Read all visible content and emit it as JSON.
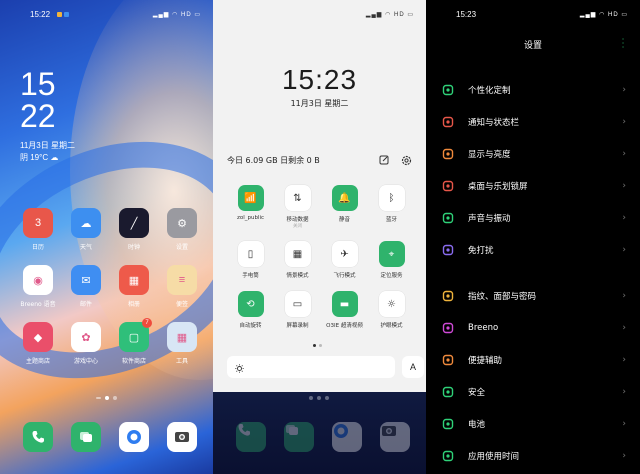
{
  "home": {
    "status_time": "15:22",
    "status_icons": "HD",
    "clock_hour": "15",
    "clock_min": "22",
    "date": "11月3日 星期二",
    "weather": "阴 19°C",
    "apps": [
      {
        "label": "日历",
        "icon": "calendar-icon",
        "color": "#e8574a",
        "glyph": "3"
      },
      {
        "label": "天气",
        "icon": "weather-icon",
        "color": "#3d8ff0",
        "glyph": "☁"
      },
      {
        "label": "时钟",
        "icon": "clock-icon",
        "color": "#1a1a2e",
        "glyph": "╱"
      },
      {
        "label": "设置",
        "icon": "settings-icon",
        "color": "#9a9aa0",
        "glyph": "⚙"
      },
      {
        "label": "Breeno 语音",
        "icon": "breeno-icon",
        "color": "#ffffff",
        "glyph": "◉"
      },
      {
        "label": "邮件",
        "icon": "mail-icon",
        "color": "#3f8ef2",
        "glyph": "✉"
      },
      {
        "label": "相册",
        "icon": "photos-icon",
        "color": "#ee5a4a",
        "glyph": "▦"
      },
      {
        "label": "便签",
        "icon": "notes-icon",
        "color": "#f6dca6",
        "glyph": "≡"
      },
      {
        "label": "主题商店",
        "icon": "theme-store-icon",
        "color": "#ea4f6a",
        "glyph": "◆"
      },
      {
        "label": "游戏中心",
        "icon": "game-center-icon",
        "color": "#ffffff",
        "glyph": "✿"
      },
      {
        "label": "软件商店",
        "icon": "app-store-icon",
        "color": "#2fbf7a",
        "glyph": "▢",
        "badge": "7"
      },
      {
        "label": "工具",
        "icon": "tools-folder-icon",
        "color": "#d8e6f5",
        "glyph": "▦"
      }
    ],
    "dock": [
      {
        "icon": "phone-icon",
        "color": "#2fb36c"
      },
      {
        "icon": "messages-icon",
        "color": "#2fb36c"
      },
      {
        "icon": "browser-icon",
        "color": "#ffffff"
      },
      {
        "icon": "camera-icon",
        "color": "#ffffff"
      }
    ]
  },
  "cc": {
    "status_icons": "HD",
    "time": "15:23",
    "date": "11月3日 星期二",
    "data_usage": "今日 6.09 GB 日剩余 0 B",
    "tiles": [
      {
        "label": "zol_public",
        "sub": "",
        "on": true,
        "icon": "wifi-icon",
        "glyph": "📶"
      },
      {
        "label": "移动数据",
        "sub": "关闭",
        "on": false,
        "icon": "mobile-data-icon",
        "glyph": "⇅"
      },
      {
        "label": "静音",
        "sub": "",
        "on": true,
        "icon": "mute-icon",
        "glyph": "🔔"
      },
      {
        "label": "蓝牙",
        "sub": "",
        "on": false,
        "icon": "bluetooth-icon",
        "glyph": "ᛒ"
      },
      {
        "label": "手电筒",
        "sub": "",
        "on": false,
        "icon": "flashlight-icon",
        "glyph": "▯"
      },
      {
        "label": "情景模式",
        "sub": "",
        "on": false,
        "icon": "scene-mode-icon",
        "glyph": "▦"
      },
      {
        "label": "飞行模式",
        "sub": "",
        "on": false,
        "icon": "airplane-icon",
        "glyph": "✈"
      },
      {
        "label": "定位服务",
        "sub": "",
        "on": true,
        "icon": "location-icon",
        "glyph": "⌖"
      },
      {
        "label": "自动旋转",
        "sub": "",
        "on": true,
        "icon": "auto-rotate-icon",
        "glyph": "⟲"
      },
      {
        "label": "屏幕录制",
        "sub": "",
        "on": false,
        "icon": "screen-record-icon",
        "glyph": "▭"
      },
      {
        "label": "O3IE 超清视频",
        "sub": "",
        "on": true,
        "icon": "video-enhance-icon",
        "glyph": "▬"
      },
      {
        "label": "护眼模式",
        "sub": "",
        "on": false,
        "icon": "eye-comfort-icon",
        "glyph": "☼"
      }
    ],
    "auto_brightness_label": "A"
  },
  "settings": {
    "status_time": "15:23",
    "status_icons": "HD",
    "title": "设置",
    "groups": [
      [
        {
          "label": "个性化定制",
          "icon": "palette-icon",
          "color": "#2fd279"
        },
        {
          "label": "通知与状态栏",
          "icon": "notification-icon",
          "color": "#e8574a"
        },
        {
          "label": "显示与亮度",
          "icon": "display-icon",
          "color": "#f08a3c"
        },
        {
          "label": "桌面与乐划锁屏",
          "icon": "desktop-icon",
          "color": "#e8574a"
        },
        {
          "label": "声音与振动",
          "icon": "sound-icon",
          "color": "#2fd279"
        },
        {
          "label": "免打扰",
          "icon": "moon-icon",
          "color": "#8a6cf0"
        }
      ],
      [
        {
          "label": "指纹、面部与密码",
          "icon": "fingerprint-icon",
          "color": "#f0b43c"
        },
        {
          "label": "Breeno",
          "icon": "breeno-icon",
          "color": "#d04ad8"
        },
        {
          "label": "便捷辅助",
          "icon": "assist-icon",
          "color": "#f08a3c"
        },
        {
          "label": "安全",
          "icon": "security-icon",
          "color": "#2fd279"
        },
        {
          "label": "电池",
          "icon": "battery-icon",
          "color": "#2fd279"
        },
        {
          "label": "应用使用时间",
          "icon": "app-usage-icon",
          "color": "#2fd279"
        }
      ]
    ]
  }
}
